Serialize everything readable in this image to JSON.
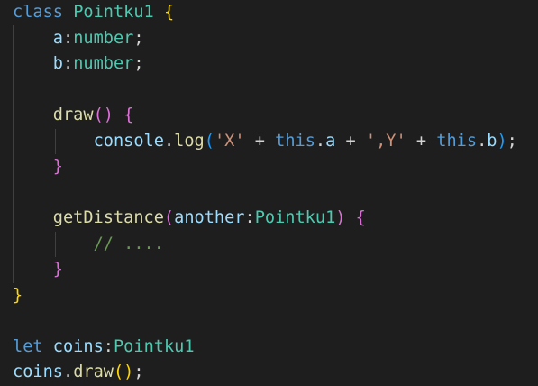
{
  "code": {
    "l1": {
      "kw": "class",
      "name": "Pointku1",
      "brace": "{"
    },
    "l2": {
      "prop": "a",
      "colon": ":",
      "type": "number",
      "semi": ";"
    },
    "l3": {
      "prop": "b",
      "colon": ":",
      "type": "number",
      "semi": ";"
    },
    "l5": {
      "fn": "draw",
      "paren": "()",
      "brace": "{"
    },
    "l6": {
      "obj": "console",
      "dot1": ".",
      "fn": "log",
      "open": "(",
      "str1": "'X'",
      "plus1": " + ",
      "this1": "this",
      "dot2": ".",
      "prop1": "a",
      "plus2": " + ",
      "str2": "',Y'",
      "plus3": " + ",
      "this2": "this",
      "dot3": ".",
      "prop2": "b",
      "close": ")",
      "semi": ";"
    },
    "l7": {
      "brace": "}"
    },
    "l9": {
      "fn": "getDistance",
      "open": "(",
      "param": "another",
      "colon": ":",
      "type": "Pointku1",
      "close": ")",
      "brace": "{"
    },
    "l10": {
      "comment": "// ...."
    },
    "l11": {
      "brace": "}"
    },
    "l12": {
      "brace": "}"
    },
    "l14": {
      "kw": "let",
      "name": "coins",
      "colon": ":",
      "type": "Pointku1"
    },
    "l15": {
      "obj": "coins",
      "dot": ".",
      "fn": "draw",
      "paren": "()",
      "semi": ";"
    }
  },
  "colors": {
    "background": "#1e1e1e",
    "keyword": "#569cd6",
    "type": "#4ec9b0",
    "function": "#dcdcaa",
    "variable": "#9cdcfe",
    "string": "#ce9178",
    "comment": "#6a9955",
    "bracket_level1": "#ffd700",
    "bracket_level2": "#da70d6",
    "bracket_level3": "#179fff"
  }
}
